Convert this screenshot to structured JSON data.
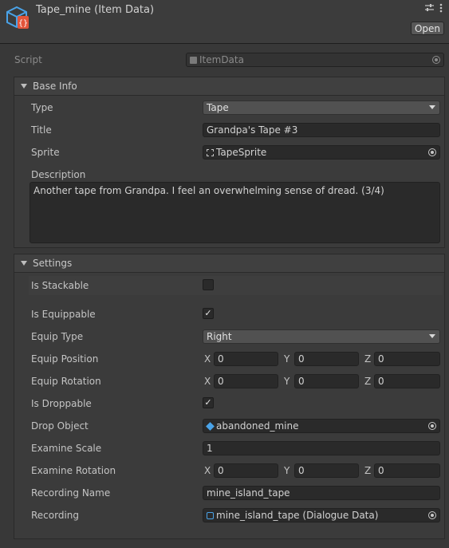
{
  "header": {
    "title": "Tape_mine (Item Data)",
    "open_label": "Open",
    "icon": "scriptable-object-icon"
  },
  "script": {
    "label": "Script",
    "value": "ItemData"
  },
  "base_info": {
    "section_label": "Base Info",
    "type_label": "Type",
    "type_value": "Tape",
    "title_label": "Title",
    "title_value": "Grandpa's Tape #3",
    "sprite_label": "Sprite",
    "sprite_value": "TapeSprite",
    "description_label": "Description",
    "description_value": "Another tape from Grandpa. I feel an overwhelming sense of dread. (3/4)"
  },
  "settings": {
    "section_label": "Settings",
    "is_stackable_label": "Is Stackable",
    "is_stackable": false,
    "is_equippable_label": "Is Equippable",
    "is_equippable": true,
    "equip_type_label": "Equip Type",
    "equip_type_value": "Right",
    "equip_position_label": "Equip Position",
    "equip_position": {
      "x_label": "X",
      "x": "0",
      "y_label": "Y",
      "y": "0",
      "z_label": "Z",
      "z": "0"
    },
    "equip_rotation_label": "Equip Rotation",
    "equip_rotation": {
      "x_label": "X",
      "x": "0",
      "y_label": "Y",
      "y": "0",
      "z_label": "Z",
      "z": "0"
    },
    "is_droppable_label": "Is Droppable",
    "is_droppable": true,
    "drop_object_label": "Drop Object",
    "drop_object_value": "abandoned_mine",
    "examine_scale_label": "Examine Scale",
    "examine_scale_value": "1",
    "examine_rotation_label": "Examine Rotation",
    "examine_rotation": {
      "x_label": "X",
      "x": "0",
      "y_label": "Y",
      "y": "0",
      "z_label": "Z",
      "z": "0"
    },
    "recording_name_label": "Recording Name",
    "recording_name_value": "mine_island_tape",
    "recording_label": "Recording",
    "recording_value": "mine_island_tape (Dialogue Data)"
  },
  "colors": {
    "background": "#383838",
    "field": "#2a2a2a",
    "dropdown": "#515151",
    "text": "#c4c4c4",
    "icon_blue": "#4aa3e8"
  }
}
